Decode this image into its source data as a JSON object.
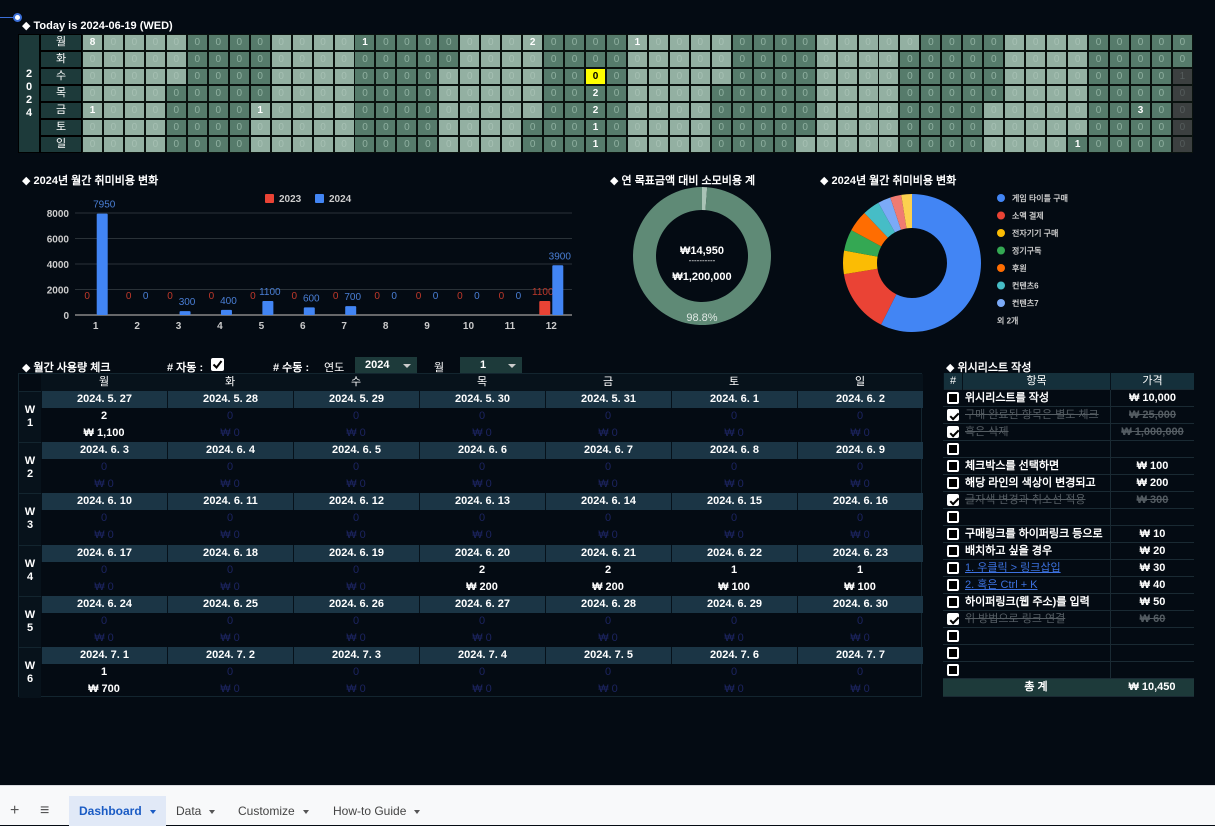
{
  "header": {
    "today_text": "◆ Today is 2024-06-19 (WED)"
  },
  "heatmap": {
    "year": "2024",
    "weekdays": [
      "월",
      "화",
      "수",
      "목",
      "금",
      "토",
      "일"
    ],
    "today": "2024-06-19",
    "counts": {
      "2024-01-01": 8,
      "2024-01-05": 1,
      "2024-03-01": 1,
      "2024-04-01": 1,
      "2024-05-27": 2,
      "2024-06-20": 2,
      "2024-06-21": 2,
      "2024-06-22": 1,
      "2024-06-23": 1,
      "2024-07-01": 1,
      "2024-12-01": 1,
      "2024-12-20": 3,
      "2025-01-01": 1
    },
    "colors": {
      "odd_month": "#93b0a2",
      "even_month": "#567b6b",
      "next_year": "#3c4040",
      "today": "#ffff00"
    }
  },
  "chart_data": [
    {
      "type": "bar",
      "title": "◆ 2024년 월간 취미비용 변화",
      "categories": [
        "1",
        "2",
        "3",
        "4",
        "5",
        "6",
        "7",
        "8",
        "9",
        "10",
        "11",
        "12"
      ],
      "series": [
        {
          "name": "2023",
          "color": "#ea4335",
          "values": [
            0,
            0,
            0,
            0,
            0,
            0,
            0,
            0,
            0,
            0,
            0,
            1100
          ]
        },
        {
          "name": "2024",
          "color": "#4285f4",
          "values": [
            7950,
            0,
            300,
            400,
            1100,
            600,
            700,
            0,
            0,
            0,
            0,
            3900
          ]
        }
      ],
      "yticks": [
        0,
        2000,
        4000,
        6000,
        8000
      ],
      "ylim": [
        0,
        8000
      ],
      "grid": true,
      "legend": "top"
    },
    {
      "type": "pie",
      "title": "◆ 연 목표금액 대비 소모비용 계",
      "values": [
        1.2,
        98.8
      ],
      "colors": [
        "#a9c3b6",
        "#5f8a76"
      ],
      "center_value": "₩14,950",
      "center_divider": "----------",
      "center_target": "₩1,200,000",
      "slice_label": "98.8%"
    },
    {
      "type": "pie",
      "title": "◆ 2024년 월간 취미비용 변화",
      "slices": [
        {
          "name": "게임 타이틀 구매",
          "value": 57.4,
          "color": "#4285f4"
        },
        {
          "name": "소액 결제",
          "value": 15.0,
          "color": "#ea4335"
        },
        {
          "name": "전자기기 구매",
          "value": 5.5,
          "color": "#fbbc04"
        },
        {
          "name": "정기구독",
          "value": 5.0,
          "color": "#34a853"
        },
        {
          "name": "후원",
          "value": 5.0,
          "color": "#ff6d01"
        },
        {
          "name": "컨텐츠6",
          "value": 4.0,
          "color": "#46bdc6"
        },
        {
          "name": "컨텐츠7",
          "value": 3.0,
          "color": "#7baaf7"
        },
        {
          "value": 2.6,
          "color": "#f07b72"
        },
        {
          "value": 2.5,
          "color": "#fcd04f"
        }
      ],
      "legend_more": "외 2개",
      "legend": "right"
    }
  ],
  "calendar": {
    "title": "◆ 월간 사용량 체크",
    "auto_label": "# 자동 :",
    "auto_checked": true,
    "manual_label": "# 수동 :",
    "year_label": "연도",
    "year_value": "2024",
    "month_label": "월",
    "month_value": "1",
    "weekdays": [
      "월",
      "화",
      "수",
      "목",
      "금",
      "토",
      "일"
    ],
    "weeks": [
      {
        "label": "W1",
        "days": [
          {
            "date": "2024. 5. 27",
            "count": "2",
            "amount": "₩ 1,100"
          },
          {
            "date": "2024. 5. 28",
            "count": "0",
            "amount": "₩ 0"
          },
          {
            "date": "2024. 5. 29",
            "count": "0",
            "amount": "₩ 0"
          },
          {
            "date": "2024. 5. 30",
            "count": "0",
            "amount": "₩ 0"
          },
          {
            "date": "2024. 5. 31",
            "count": "0",
            "amount": "₩ 0"
          },
          {
            "date": "2024. 6. 1",
            "count": "0",
            "amount": "₩ 0"
          },
          {
            "date": "2024. 6. 2",
            "count": "0",
            "amount": "₩ 0"
          }
        ]
      },
      {
        "label": "W2",
        "days": [
          {
            "date": "2024. 6. 3",
            "count": "0",
            "amount": "₩ 0"
          },
          {
            "date": "2024. 6. 4",
            "count": "0",
            "amount": "₩ 0"
          },
          {
            "date": "2024. 6. 5",
            "count": "0",
            "amount": "₩ 0"
          },
          {
            "date": "2024. 6. 6",
            "count": "0",
            "amount": "₩ 0"
          },
          {
            "date": "2024. 6. 7",
            "count": "0",
            "amount": "₩ 0"
          },
          {
            "date": "2024. 6. 8",
            "count": "0",
            "amount": "₩ 0"
          },
          {
            "date": "2024. 6. 9",
            "count": "0",
            "amount": "₩ 0"
          }
        ]
      },
      {
        "label": "W3",
        "days": [
          {
            "date": "2024. 6. 10",
            "count": "0",
            "amount": "₩ 0"
          },
          {
            "date": "2024. 6. 11",
            "count": "0",
            "amount": "₩ 0"
          },
          {
            "date": "2024. 6. 12",
            "count": "0",
            "amount": "₩ 0"
          },
          {
            "date": "2024. 6. 13",
            "count": "0",
            "amount": "₩ 0"
          },
          {
            "date": "2024. 6. 14",
            "count": "0",
            "amount": "₩ 0"
          },
          {
            "date": "2024. 6. 15",
            "count": "0",
            "amount": "₩ 0"
          },
          {
            "date": "2024. 6. 16",
            "count": "0",
            "amount": "₩ 0"
          }
        ]
      },
      {
        "label": "W4",
        "days": [
          {
            "date": "2024. 6. 17",
            "count": "0",
            "amount": "₩ 0"
          },
          {
            "date": "2024. 6. 18",
            "count": "0",
            "amount": "₩ 0"
          },
          {
            "date": "2024. 6. 19",
            "count": "0",
            "amount": "₩ 0"
          },
          {
            "date": "2024. 6. 20",
            "count": "2",
            "amount": "₩ 200"
          },
          {
            "date": "2024. 6. 21",
            "count": "2",
            "amount": "₩ 200"
          },
          {
            "date": "2024. 6. 22",
            "count": "1",
            "amount": "₩ 100"
          },
          {
            "date": "2024. 6. 23",
            "count": "1",
            "amount": "₩ 100"
          }
        ]
      },
      {
        "label": "W5",
        "days": [
          {
            "date": "2024. 6. 24",
            "count": "0",
            "amount": "₩ 0"
          },
          {
            "date": "2024. 6. 25",
            "count": "0",
            "amount": "₩ 0"
          },
          {
            "date": "2024. 6. 26",
            "count": "0",
            "amount": "₩ 0"
          },
          {
            "date": "2024. 6. 27",
            "count": "0",
            "amount": "₩ 0"
          },
          {
            "date": "2024. 6. 28",
            "count": "0",
            "amount": "₩ 0"
          },
          {
            "date": "2024. 6. 29",
            "count": "0",
            "amount": "₩ 0"
          },
          {
            "date": "2024. 6. 30",
            "count": "0",
            "amount": "₩ 0"
          }
        ]
      },
      {
        "label": "W6",
        "days": [
          {
            "date": "2024. 7. 1",
            "count": "1",
            "amount": "₩ 700"
          },
          {
            "date": "2024. 7. 2",
            "count": "0",
            "amount": "₩ 0"
          },
          {
            "date": "2024. 7. 3",
            "count": "0",
            "amount": "₩ 0"
          },
          {
            "date": "2024. 7. 4",
            "count": "0",
            "amount": "₩ 0"
          },
          {
            "date": "2024. 7. 5",
            "count": "0",
            "amount": "₩ 0"
          },
          {
            "date": "2024. 7. 6",
            "count": "0",
            "amount": "₩ 0"
          },
          {
            "date": "2024. 7. 7",
            "count": "0",
            "amount": "₩ 0"
          }
        ]
      }
    ]
  },
  "wishlist": {
    "title": "◆ 위시리스트 작성",
    "headers": {
      "num": "#",
      "item": "항목",
      "price": "가격"
    },
    "items": [
      {
        "checked": false,
        "item": "위시리스트를 작성",
        "price": "₩ 10,000"
      },
      {
        "checked": true,
        "item": "구매 완료된 항목은 별도 체크",
        "price": "₩ 25,000"
      },
      {
        "checked": true,
        "item": "혹은 삭제",
        "price": "₩ 1,000,000"
      },
      {
        "checked": false,
        "item": "",
        "price": ""
      },
      {
        "checked": false,
        "item": "체크박스를 선택하면",
        "price": "₩ 100"
      },
      {
        "checked": false,
        "item": "해당 라인의 색상이 변경되고",
        "price": "₩ 200"
      },
      {
        "checked": true,
        "item": "글자색 변경과 취소선 적용",
        "price": "₩ 300"
      },
      {
        "checked": false,
        "item": "",
        "price": ""
      },
      {
        "checked": false,
        "item": "구매링크를 하이퍼링크 등으로",
        "price": "₩ 10"
      },
      {
        "checked": false,
        "item": "배치하고 싶을 경우",
        "price": "₩ 20"
      },
      {
        "checked": false,
        "item": "1. 우클릭 > 링크삽입",
        "price": "₩ 30",
        "link": true
      },
      {
        "checked": false,
        "item": "2. 혹은 Ctrl + K",
        "price": "₩ 40",
        "link": true
      },
      {
        "checked": false,
        "item": "하이퍼링크(웹 주소)를 입력",
        "price": "₩ 50"
      },
      {
        "checked": true,
        "item": "위 방법으로 링크 연결",
        "price": "₩ 60"
      },
      {
        "checked": false,
        "item": "",
        "price": ""
      },
      {
        "checked": false,
        "item": "",
        "price": ""
      },
      {
        "checked": false,
        "item": "",
        "price": ""
      }
    ],
    "total_label": "총 계",
    "total_value": "₩ 10,450"
  },
  "sheet_tabs": {
    "add_icon": "+",
    "menu_icon": "≡",
    "tabs": [
      {
        "label": "Dashboard",
        "active": true
      },
      {
        "label": "Data",
        "active": false
      },
      {
        "label": "Customize",
        "active": false
      },
      {
        "label": "How-to Guide",
        "active": false
      }
    ]
  }
}
